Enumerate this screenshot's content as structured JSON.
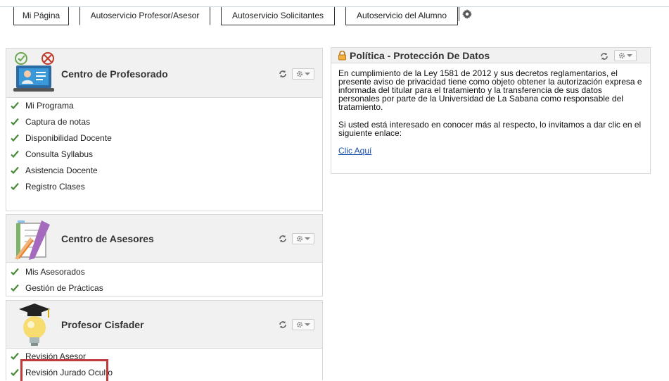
{
  "tabs": [
    {
      "label": "Mi Página"
    },
    {
      "label": "Autoservicio Profesor/Asesor"
    },
    {
      "label": "Autoservicio Solicitantes"
    },
    {
      "label": "Autoservicio del Alumno"
    }
  ],
  "pagelets": {
    "profesorado": {
      "title": "Centro de Profesorado",
      "links": [
        "Mi Programa",
        "Captura de notas",
        "Disponibilidad Docente",
        "Consulta Syllabus",
        "Asistencia Docente",
        "Registro Clases"
      ]
    },
    "asesores": {
      "title": "Centro de Asesores",
      "links": [
        "Mis Asesorados",
        "Gestión de Prácticas"
      ]
    },
    "cisfader": {
      "title": "Profesor Cisfader",
      "links": [
        "Revisión Asesor",
        "Revisión Jurado Oculto"
      ]
    },
    "politica": {
      "title": "Política - Protección De Datos",
      "paragraph1": "En cumplimiento de la Ley 1581 de 2012 y sus decretos reglamentarios, el presente aviso de privacidad tiene como objeto obtener la autorización expresa e informada del titular para el tratamiento y la transferencia de sus datos personales por parte de la Universidad de La Sabana como responsable del tratamiento.",
      "paragraph2": "Si usted está interesado en conocer más al respecto, lo invitamos a dar clic en el siguiente enlace:",
      "link": "Clic Aquí"
    }
  },
  "colors": {
    "check": "#4a8a3a",
    "link": "#1b50a8",
    "highlight": "#c0393b",
    "header_bg": "#f1f1f1"
  }
}
